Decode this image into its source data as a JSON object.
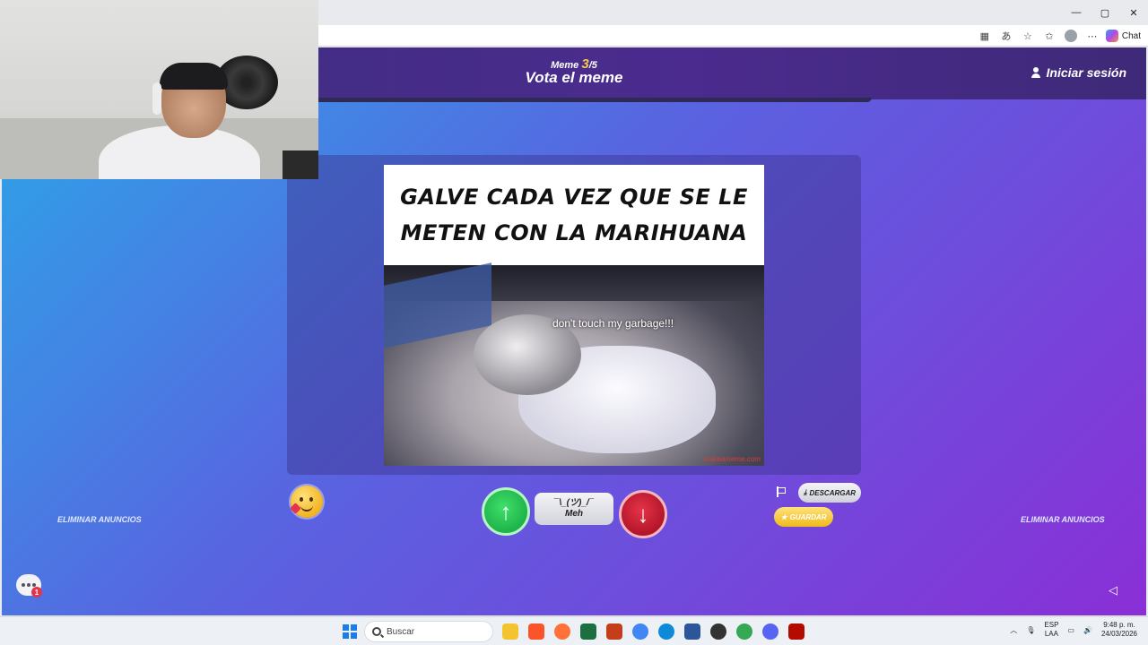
{
  "browser": {
    "window_controls": {
      "minimize": "—",
      "maximize": "▢",
      "close": "✕"
    },
    "toolbar_icons": [
      "apps-icon",
      "translate-icon",
      "favorite-star-icon",
      "collections-icon",
      "profile-icon",
      "more-icon"
    ],
    "chat_label": "Chat"
  },
  "header": {
    "counter_prefix": "Meme",
    "counter_current": "3",
    "counter_total": "/5",
    "title": "Vota el meme",
    "login_label": "Iniciar sesión"
  },
  "meme": {
    "caption": "GALVE CADA VEZ QUE SE LE METEN CON LA MARIHUANA",
    "photo_text": "don't touch my garbage!!!",
    "watermark": "makeameme.com"
  },
  "actions": {
    "upvote_icon": "arrow-up-icon",
    "meh_face": "¯\\_(ツ)_/¯",
    "meh_label": "Meh",
    "downvote_icon": "arrow-down-icon",
    "download_label": "DESCARGAR",
    "save_label": "GUARDAR",
    "remove_ads_left": "ELIMINAR ANUNCIOS",
    "remove_ads_right": "ELIMINAR ANUNCIOS",
    "chat_badge": "1"
  },
  "taskbar": {
    "search_placeholder": "Buscar",
    "lang_top": "ESP",
    "lang_bottom": "LAA",
    "time": "9:48 p. m.",
    "date": "24/03/2026",
    "apps": [
      "file-explorer-icon",
      "brave-icon",
      "firefox-icon",
      "excel-icon",
      "powerpoint-icon",
      "chrome-icon",
      "edge-icon",
      "word-icon",
      "app-icon",
      "chrome-profile-icon",
      "discord-icon",
      "acrobat-icon"
    ]
  },
  "colors": {
    "upvote": "#1fb34a",
    "downvote": "#b3152a",
    "save": "#f0b91c",
    "header_bg": "#3d2f7f",
    "accent_yellow": "#f7c948"
  }
}
